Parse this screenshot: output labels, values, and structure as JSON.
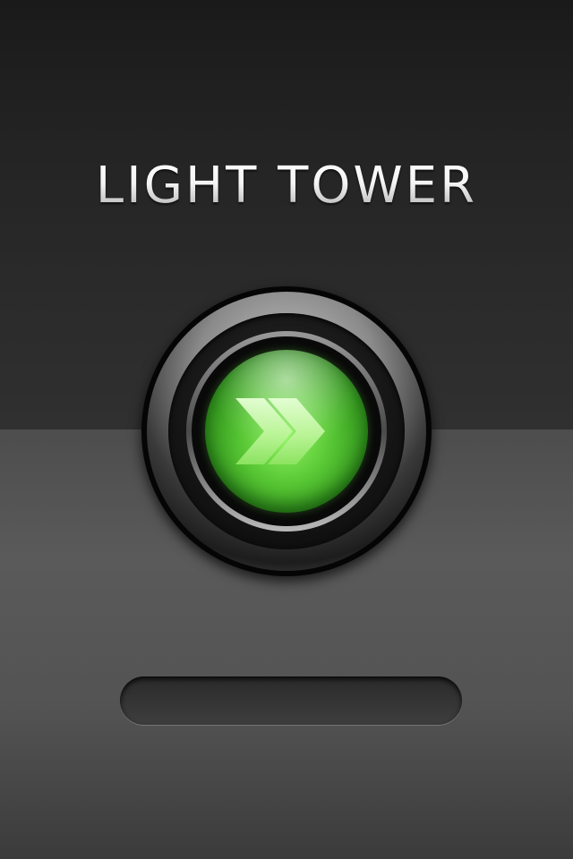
{
  "app": {
    "title": "LIGHT TOWER"
  },
  "power_button": {
    "icon": "double-chevron-right-icon",
    "accent_color": "#56c533"
  },
  "colors": {
    "top_background": "#242424",
    "bottom_background": "#555555",
    "title_text": "#f0f0f0"
  }
}
